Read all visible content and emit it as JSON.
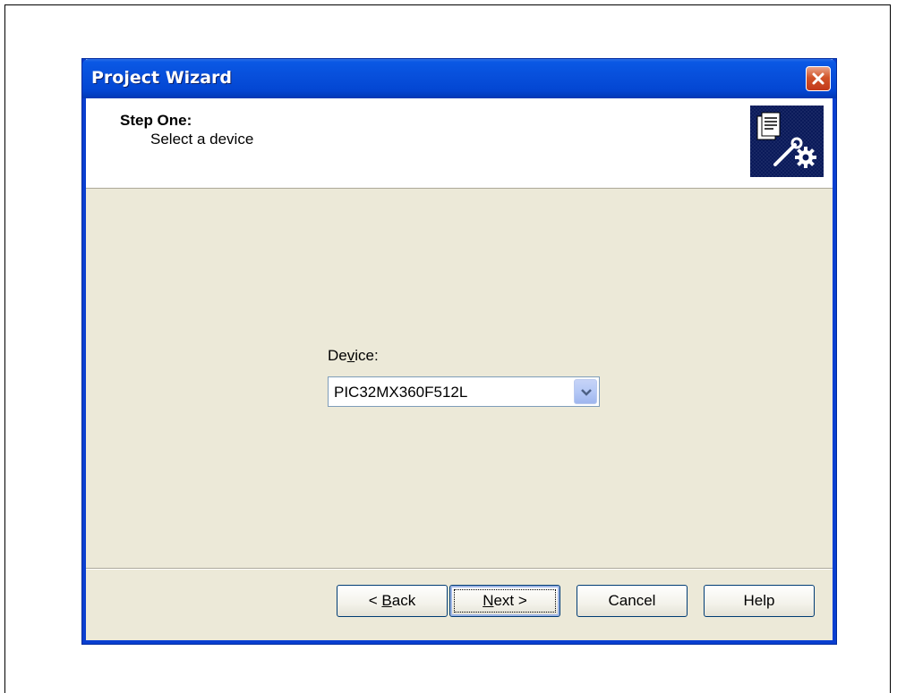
{
  "window": {
    "title": "Project Wizard"
  },
  "header": {
    "step_title": "Step One:",
    "step_subtitle": "Select a device"
  },
  "device": {
    "label_before": "De",
    "label_mnemonic": "v",
    "label_after": "ice:",
    "selected": "PIC32MX360F512L"
  },
  "buttons": {
    "back": {
      "prefix": "< ",
      "mnemonic": "B",
      "rest": "ack"
    },
    "next": {
      "mnemonic": "N",
      "rest": "ext >"
    },
    "cancel": "Cancel",
    "help": "Help"
  },
  "icons": [
    "close-icon",
    "wizard-icon",
    "chevron-down-icon"
  ],
  "colors": {
    "titlebar": "#0850dc",
    "dialog_bg": "#ece9d8",
    "close": "#d1542a"
  }
}
